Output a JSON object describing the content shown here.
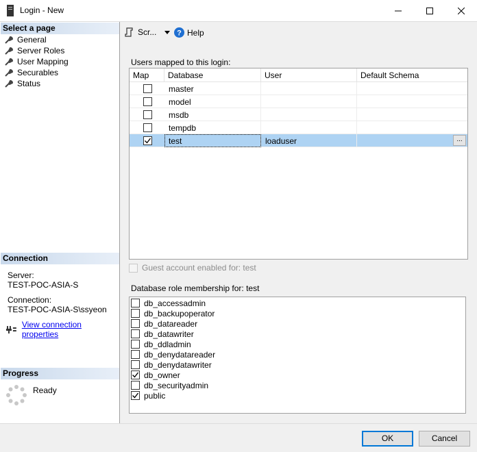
{
  "window": {
    "title": "Login - New"
  },
  "left": {
    "select_header": "Select a page",
    "pages": [
      "General",
      "Server Roles",
      "User Mapping",
      "Securables",
      "Status"
    ],
    "connection_header": "Connection",
    "server_label": "Server:",
    "server_value": "TEST-POC-ASIA-S",
    "connection_label": "Connection:",
    "connection_value": "TEST-POC-ASIA-S\\ssyeon",
    "view_link": "View connection properties",
    "progress_header": "Progress",
    "progress_status": "Ready"
  },
  "toolbar": {
    "script_label": "Scr...",
    "help_label": "Help"
  },
  "mapping": {
    "label": "Users mapped to this login:",
    "columns": [
      "Map",
      "Database",
      "User",
      "Default Schema"
    ],
    "rows": [
      {
        "map": false,
        "database": "master",
        "user": "",
        "schema": ""
      },
      {
        "map": false,
        "database": "model",
        "user": "",
        "schema": ""
      },
      {
        "map": false,
        "database": "msdb",
        "user": "",
        "schema": ""
      },
      {
        "map": false,
        "database": "tempdb",
        "user": "",
        "schema": ""
      },
      {
        "map": true,
        "database": "test",
        "user": "loaduser",
        "schema": ""
      }
    ],
    "browse_label": "..."
  },
  "guest": {
    "label": "Guest account enabled for: test",
    "checked": false
  },
  "roles": {
    "label": "Database role membership for: test",
    "items": [
      {
        "name": "db_accessadmin",
        "checked": false
      },
      {
        "name": "db_backupoperator",
        "checked": false
      },
      {
        "name": "db_datareader",
        "checked": false
      },
      {
        "name": "db_datawriter",
        "checked": false
      },
      {
        "name": "db_ddladmin",
        "checked": false
      },
      {
        "name": "db_denydatareader",
        "checked": false
      },
      {
        "name": "db_denydatawriter",
        "checked": false
      },
      {
        "name": "db_owner",
        "checked": true
      },
      {
        "name": "db_securityadmin",
        "checked": false
      },
      {
        "name": "public",
        "checked": true
      }
    ]
  },
  "buttons": {
    "ok": "OK",
    "cancel": "Cancel"
  }
}
